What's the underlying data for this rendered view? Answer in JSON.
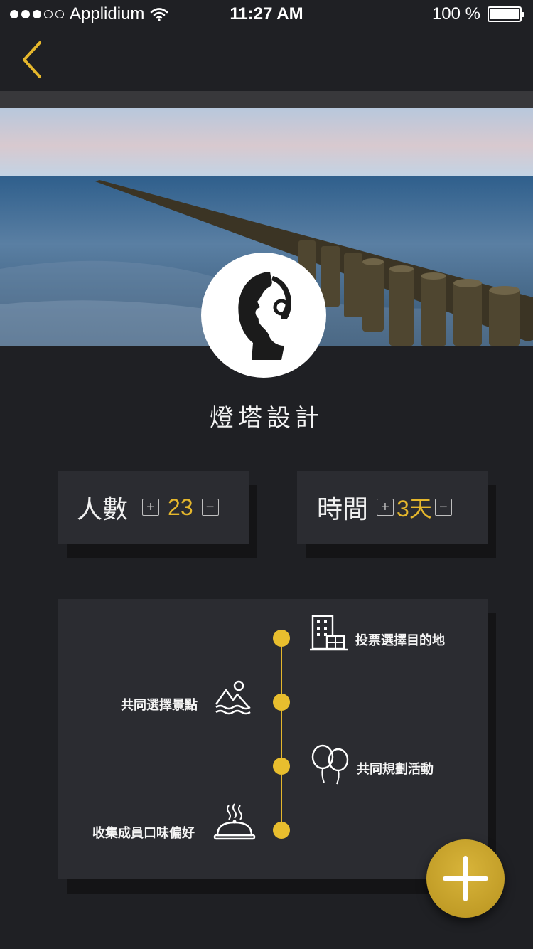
{
  "status_bar": {
    "carrier": "Applidium",
    "time": "11:27 AM",
    "battery": "100 %"
  },
  "header": {
    "back_icon": "chevron-left-icon"
  },
  "team": {
    "name": "燈塔設計",
    "avatar_icon": "astronaut-helmet-icon"
  },
  "people": {
    "label": "人數",
    "value": "23",
    "plus": "+",
    "minus": "−"
  },
  "duration": {
    "label": "時間",
    "value": "3天",
    "plus": "+",
    "minus": "−"
  },
  "timeline": {
    "items": [
      {
        "label": "投票選擇目的地",
        "icon": "building-icon"
      },
      {
        "label": "共同選擇景點",
        "icon": "mountain-scenery-icon"
      },
      {
        "label": "共同規劃活動",
        "icon": "balloons-icon"
      },
      {
        "label": "收集成員口味偏好",
        "icon": "food-cloche-icon"
      }
    ]
  },
  "fab": {
    "icon": "plus-icon"
  },
  "colors": {
    "accent": "#e5b72c",
    "background": "#1f2024",
    "card": "#2b2c31"
  }
}
